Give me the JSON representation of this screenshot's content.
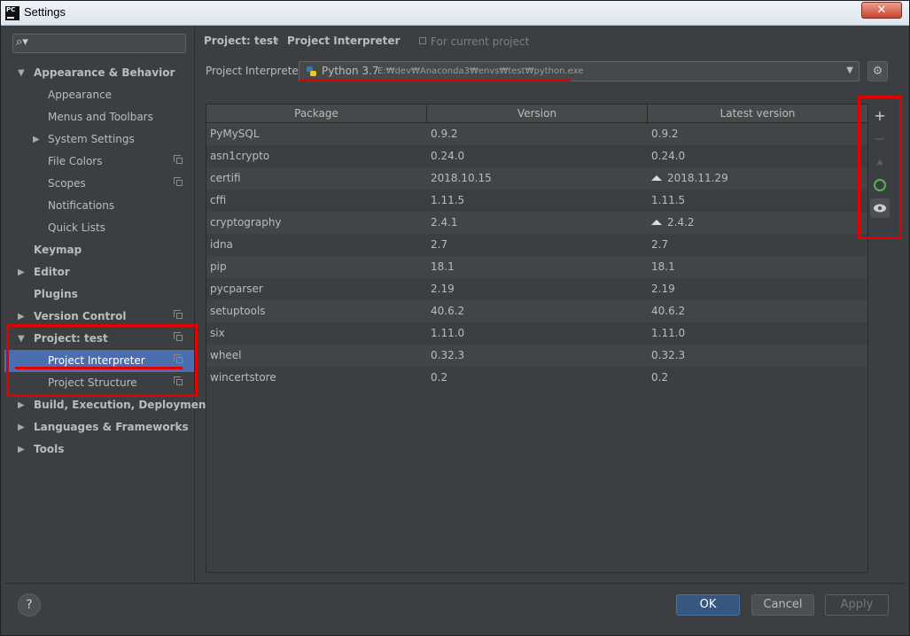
{
  "window": {
    "title": "Settings",
    "app_icon": "PC"
  },
  "sidebar": {
    "search_placeholder": "",
    "items": [
      {
        "label": "Appearance & Behavior",
        "expanded": true
      },
      {
        "label": "Appearance"
      },
      {
        "label": "Menus and Toolbars"
      },
      {
        "label": "System Settings",
        "expanded": false
      },
      {
        "label": "File Colors"
      },
      {
        "label": "Scopes"
      },
      {
        "label": "Notifications"
      },
      {
        "label": "Quick Lists"
      },
      {
        "label": "Keymap"
      },
      {
        "label": "Editor",
        "expanded": false
      },
      {
        "label": "Plugins"
      },
      {
        "label": "Version Control",
        "expanded": false
      },
      {
        "label": "Project: test",
        "expanded": true
      },
      {
        "label": "Project Interpreter",
        "selected": true
      },
      {
        "label": "Project Structure"
      },
      {
        "label": "Build, Execution, Deployment",
        "expanded": false
      },
      {
        "label": "Languages & Frameworks",
        "expanded": false
      },
      {
        "label": "Tools",
        "expanded": false
      }
    ]
  },
  "breadcrumb": {
    "parent": "Project: test",
    "separator": "›",
    "current": "Project Interpreter",
    "scope": "For current project"
  },
  "interpreter": {
    "label": "Project Interpreter:",
    "name": "Python 3.7",
    "path": "E:₩dev₩Anaconda3₩envs₩test₩python.exe"
  },
  "table": {
    "headers": [
      "Package",
      "Version",
      "Latest version"
    ],
    "rows": [
      {
        "package": "PyMySQL",
        "version": "0.9.2",
        "latest": "0.9.2",
        "upgrade": false
      },
      {
        "package": "asn1crypto",
        "version": "0.24.0",
        "latest": "0.24.0",
        "upgrade": false
      },
      {
        "package": "certifi",
        "version": "2018.10.15",
        "latest": "2018.11.29",
        "upgrade": true
      },
      {
        "package": "cffi",
        "version": "1.11.5",
        "latest": "1.11.5",
        "upgrade": false
      },
      {
        "package": "cryptography",
        "version": "2.4.1",
        "latest": "2.4.2",
        "upgrade": true
      },
      {
        "package": "idna",
        "version": "2.7",
        "latest": "2.7",
        "upgrade": false
      },
      {
        "package": "pip",
        "version": "18.1",
        "latest": "18.1",
        "upgrade": false
      },
      {
        "package": "pycparser",
        "version": "2.19",
        "latest": "2.19",
        "upgrade": false
      },
      {
        "package": "setuptools",
        "version": "40.6.2",
        "latest": "40.6.2",
        "upgrade": false
      },
      {
        "package": "six",
        "version": "1.11.0",
        "latest": "1.11.0",
        "upgrade": false
      },
      {
        "package": "wheel",
        "version": "0.32.3",
        "latest": "0.32.3",
        "upgrade": false
      },
      {
        "package": "wincertstore",
        "version": "0.2",
        "latest": "0.2",
        "upgrade": false
      }
    ]
  },
  "tools": {
    "add": "+",
    "remove": "−",
    "upgrade": "▲"
  },
  "buttons": {
    "help": "?",
    "ok": "OK",
    "cancel": "Cancel",
    "apply": "Apply"
  },
  "colors": {
    "background": "#3c3f41",
    "selection": "#4b6eaf",
    "annotation_red": "#e50000",
    "ok_button": "#365880",
    "conda_green": "#50b848"
  }
}
